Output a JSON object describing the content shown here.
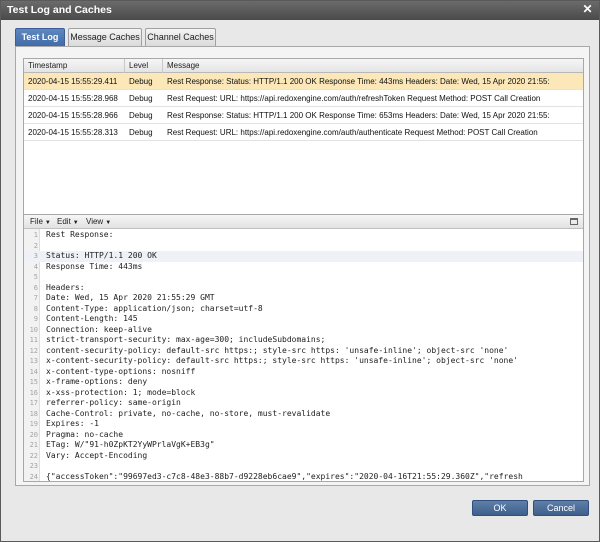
{
  "window": {
    "title": "Test Log and Caches"
  },
  "tabs": [
    {
      "label": "Test Log"
    },
    {
      "label": "Message Caches"
    },
    {
      "label": "Channel Caches"
    }
  ],
  "grid": {
    "columns": [
      "Timestamp",
      "Level",
      "Message"
    ],
    "rows": [
      {
        "timestamp": "2020-04-15 15:55:29.411",
        "level": "Debug",
        "message": "Rest Response: Status: HTTP/1.1 200 OK Response Time: 443ms Headers: Date: Wed, 15 Apr 2020 21:55:"
      },
      {
        "timestamp": "2020-04-15 15:55:28.968",
        "level": "Debug",
        "message": "Rest Request: URL: https://api.redoxengine.com/auth/refreshToken Request Method: POST Call Creation"
      },
      {
        "timestamp": "2020-04-15 15:55:28.966",
        "level": "Debug",
        "message": "Rest Response: Status: HTTP/1.1 200 OK Response Time: 653ms Headers: Date: Wed, 15 Apr 2020 21:55:"
      },
      {
        "timestamp": "2020-04-15 15:55:28.313",
        "level": "Debug",
        "message": "Rest Request: URL: https://api.redoxengine.com/auth/authenticate Request Method: POST Call Creation"
      }
    ]
  },
  "viewer": {
    "menus": {
      "file": "File",
      "edit": "Edit",
      "view": "View"
    },
    "lines": [
      {
        "num": "1",
        "text": "Rest Response:"
      },
      {
        "num": "2",
        "text": ""
      },
      {
        "num": "3",
        "text": "Status: HTTP/1.1 200 OK"
      },
      {
        "num": "4",
        "text": "Response Time: 443ms"
      },
      {
        "num": "5",
        "text": ""
      },
      {
        "num": "6",
        "text": "Headers:"
      },
      {
        "num": "7",
        "text": "Date: Wed, 15 Apr 2020 21:55:29 GMT"
      },
      {
        "num": "8",
        "text": "Content-Type: application/json; charset=utf-8"
      },
      {
        "num": "9",
        "text": "Content-Length: 145"
      },
      {
        "num": "10",
        "text": "Connection: keep-alive"
      },
      {
        "num": "11",
        "text": "strict-transport-security: max-age=300; includeSubdomains;"
      },
      {
        "num": "12",
        "text": "content-security-policy: default-src https:; style-src https: 'unsafe-inline'; object-src 'none'"
      },
      {
        "num": "13",
        "text": "x-content-security-policy: default-src https:; style-src https: 'unsafe-inline'; object-src 'none'"
      },
      {
        "num": "14",
        "text": "x-content-type-options: nosniff"
      },
      {
        "num": "15",
        "text": "x-frame-options: deny"
      },
      {
        "num": "16",
        "text": "x-xss-protection: 1; mode=block"
      },
      {
        "num": "17",
        "text": "referrer-policy: same-origin"
      },
      {
        "num": "18",
        "text": "Cache-Control: private, no-cache, no-store, must-revalidate"
      },
      {
        "num": "19",
        "text": "Expires: -1"
      },
      {
        "num": "20",
        "text": "Pragma: no-cache"
      },
      {
        "num": "21",
        "text": "ETag: W/\"91-h0ZpKT2YyWPrlaVgK+EB3g\""
      },
      {
        "num": "22",
        "text": "Vary: Accept-Encoding"
      },
      {
        "num": "23",
        "text": ""
      },
      {
        "num": "24",
        "text": "{\"accessToken\":\"99697ed3-c7c8-48e3-88b7-d9228eb6cae9\",\"expires\":\"2020-04-16T21:55:29.360Z\",\"refresh"
      }
    ]
  },
  "buttons": {
    "ok": "OK",
    "cancel": "Cancel"
  }
}
